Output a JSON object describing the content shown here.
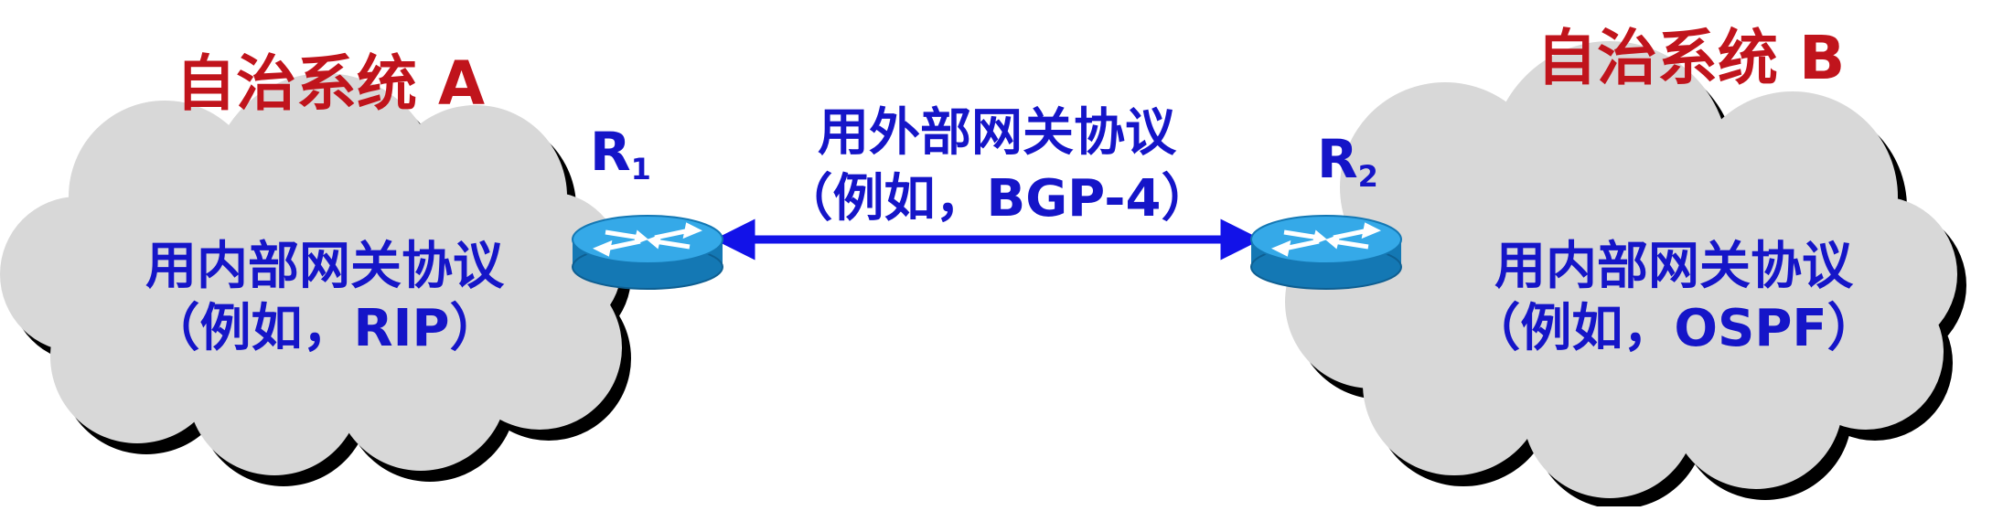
{
  "as_a": {
    "title": "自治系统 A",
    "protocol_line1": "用内部网关协议",
    "protocol_line2": "（例如，RIP）"
  },
  "as_b": {
    "title": "自治系统 B",
    "protocol_line1": "用内部网关协议",
    "protocol_line2": "（例如，OSPF）"
  },
  "link": {
    "line1": "用外部网关协议",
    "line2": "（例如，BGP-4）"
  },
  "router1": {
    "letter": "R",
    "index": "1"
  },
  "router2": {
    "letter": "R",
    "index": "2"
  },
  "colors": {
    "title": "#c0141c",
    "text": "#1515c8",
    "arrow": "#1212e8",
    "cloud_fill": "#d8d8d8",
    "cloud_shadow": "#000000",
    "router_top": "#35a9e8",
    "router_side": "#1478b4"
  }
}
